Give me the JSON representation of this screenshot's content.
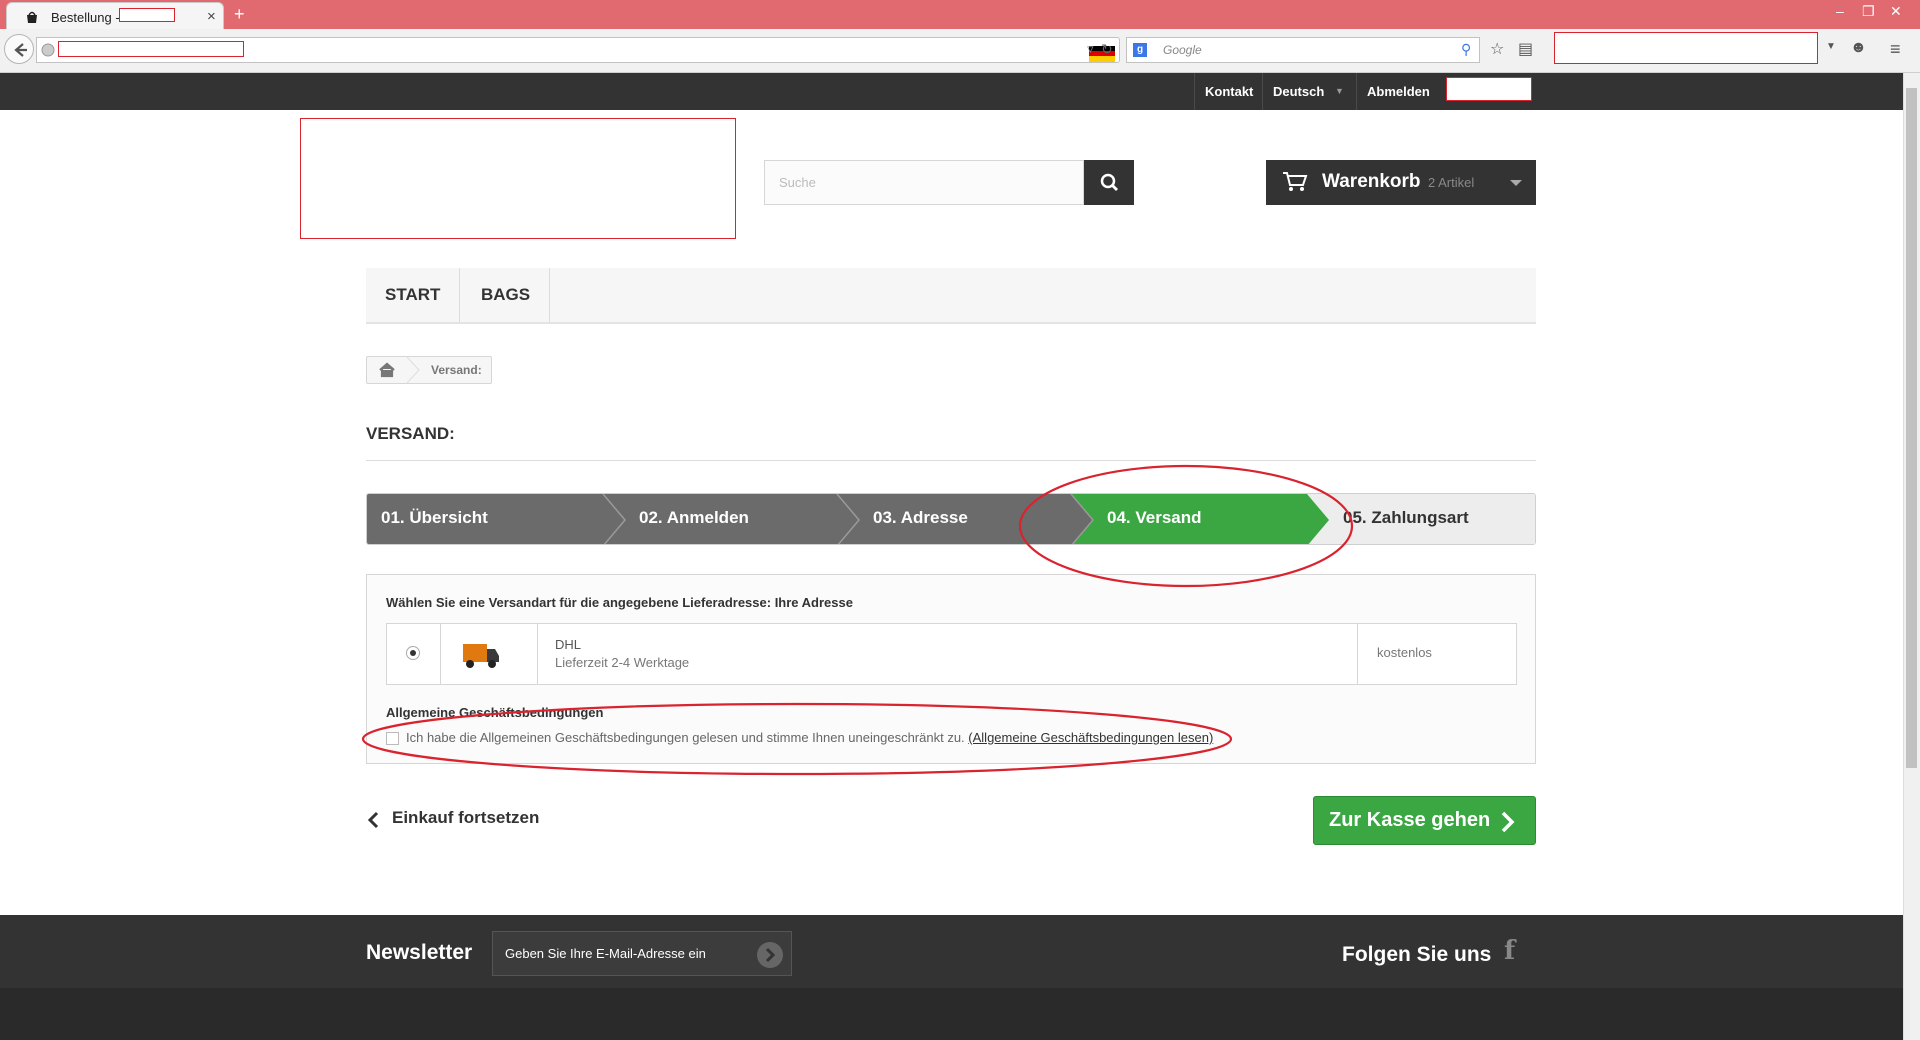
{
  "browser": {
    "tab_title": "Bestellung -",
    "new_tab": "+",
    "close_tab": "×",
    "search_engine_placeholder": "Google"
  },
  "topbar": {
    "contact": "Kontakt",
    "language": "Deutsch",
    "logout": "Abmelden"
  },
  "header": {
    "search_placeholder": "Suche",
    "cart_label": "Warenkorb",
    "cart_count": "2 Artikel"
  },
  "menu": [
    {
      "label": "START"
    },
    {
      "label": "BAGS"
    }
  ],
  "breadcrumb": {
    "current": "Versand:"
  },
  "page_title": "VERSAND:",
  "steps": [
    {
      "label": "01. Übersicht",
      "state": "done"
    },
    {
      "label": "02. Anmelden",
      "state": "done"
    },
    {
      "label": "03. Adresse",
      "state": "done"
    },
    {
      "label": "04. Versand",
      "state": "current"
    },
    {
      "label": "05. Zahlungsart",
      "state": "todo"
    }
  ],
  "shipping": {
    "intro": "Wählen Sie eine Versandart für die angegebene Lieferadresse: Ihre Adresse",
    "carrier": "DHL",
    "delivery_time": "Lieferzeit 2-4 Werktage",
    "price": "kostenlos",
    "terms_title": "Allgemeine Geschäftsbedingungen",
    "terms_text": "Ich habe die Allgemeinen Geschäftsbedingungen gelesen und stimme Ihnen uneingeschränkt zu.",
    "terms_link": "(Allgemeine Geschäftsbedingungen lesen)"
  },
  "actions": {
    "continue_shopping": "Einkauf fortsetzen",
    "checkout": "Zur Kasse gehen"
  },
  "footer": {
    "newsletter_title": "Newsletter",
    "newsletter_placeholder": "Geben Sie Ihre E-Mail-Adresse ein",
    "follow_us": "Folgen Sie uns"
  },
  "colors": {
    "accent_green": "#3aa742",
    "dark": "#333333",
    "step_grey": "#6b6b6b",
    "annotation_red": "#d9232e"
  }
}
